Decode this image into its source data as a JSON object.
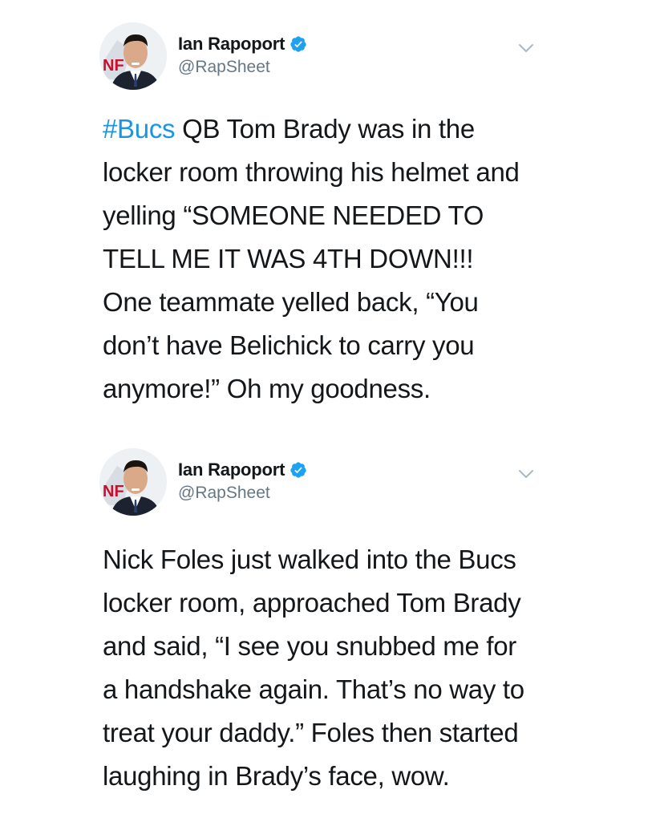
{
  "tweets": [
    {
      "author": {
        "display_name": "Ian Rapoport",
        "handle": "@RapSheet",
        "verified": true,
        "avatar_icon": "avatar-portrait"
      },
      "menu_icon": "chevron-down-icon",
      "hashtag": "#Bucs",
      "lines": [
        " QB Tom Brady was in the",
        "locker room throwing his helmet and",
        "yelling “SOMEONE NEEDED TO",
        "TELL ME IT WAS 4TH DOWN!!!",
        "One teammate yelled back, “You",
        "don’t have Belichick to carry you",
        "anymore!” Oh my goodness."
      ]
    },
    {
      "author": {
        "display_name": "Ian Rapoport",
        "handle": "@RapSheet",
        "verified": true,
        "avatar_icon": "avatar-portrait"
      },
      "menu_icon": "chevron-down-icon",
      "lines": [
        "Nick Foles just walked into the Bucs",
        "locker room, approached Tom Brady",
        "and said, “I see you snubbed me for",
        "a handshake again. That’s no way to",
        "treat your daddy.” Foles then started",
        "laughing in Brady’s face, wow."
      ]
    }
  ],
  "colors": {
    "link": "#1b95e0",
    "verified": "#1da1f2",
    "handle": "#657786",
    "text": "#14171a"
  }
}
